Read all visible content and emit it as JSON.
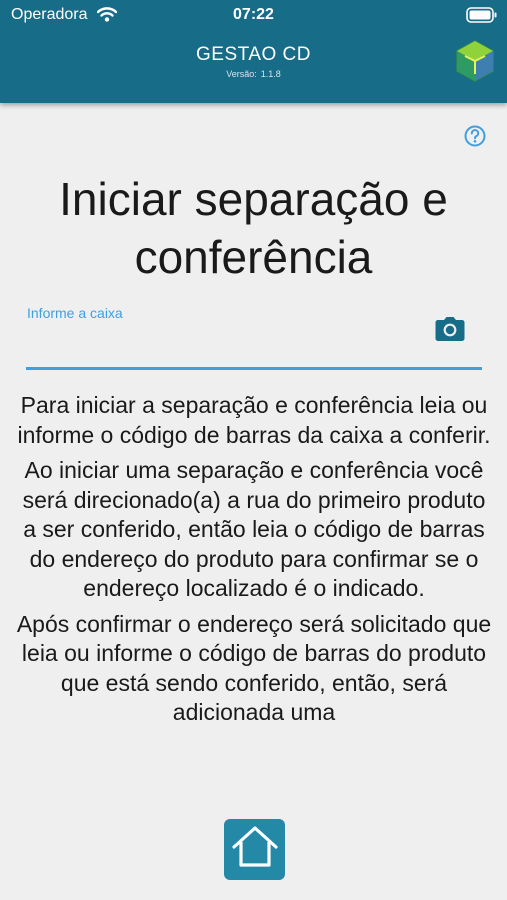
{
  "status_bar": {
    "carrier": "Operadora",
    "time": "07:22"
  },
  "header": {
    "title": "GESTAO CD",
    "version_label": "Versão:",
    "version_number": "1.1.8",
    "logo_icon": "cube-logo-icon"
  },
  "help": {
    "icon": "question-circle-icon"
  },
  "page": {
    "title_line1": "Iniciar separação e",
    "title_line2": "conferência"
  },
  "box_field": {
    "label": "Informe a caixa",
    "value": "",
    "placeholder": "",
    "camera_icon": "camera-icon"
  },
  "instructions": {
    "paragraph1": "Para iniciar a separação e conferência leia ou informe o código de barras da caixa a conferir.",
    "paragraph2": "Ao iniciar uma separação e conferência você será direcionado(a) a rua do primeiro produto a ser conferido, então leia o código de barras do endereço do produto para confirmar se o endereço localizado é o indicado.",
    "paragraph3": "Após confirmar o endereço será solicitado que leia ou informe o código de barras do produto que está sendo conferido, então, será adicionada uma"
  },
  "footer": {
    "home_icon": "home-icon"
  },
  "colors": {
    "header_bg": "#176c87",
    "accent": "#3f9fe0",
    "home_button_bg": "#2389a6",
    "page_bg": "#efefef"
  }
}
